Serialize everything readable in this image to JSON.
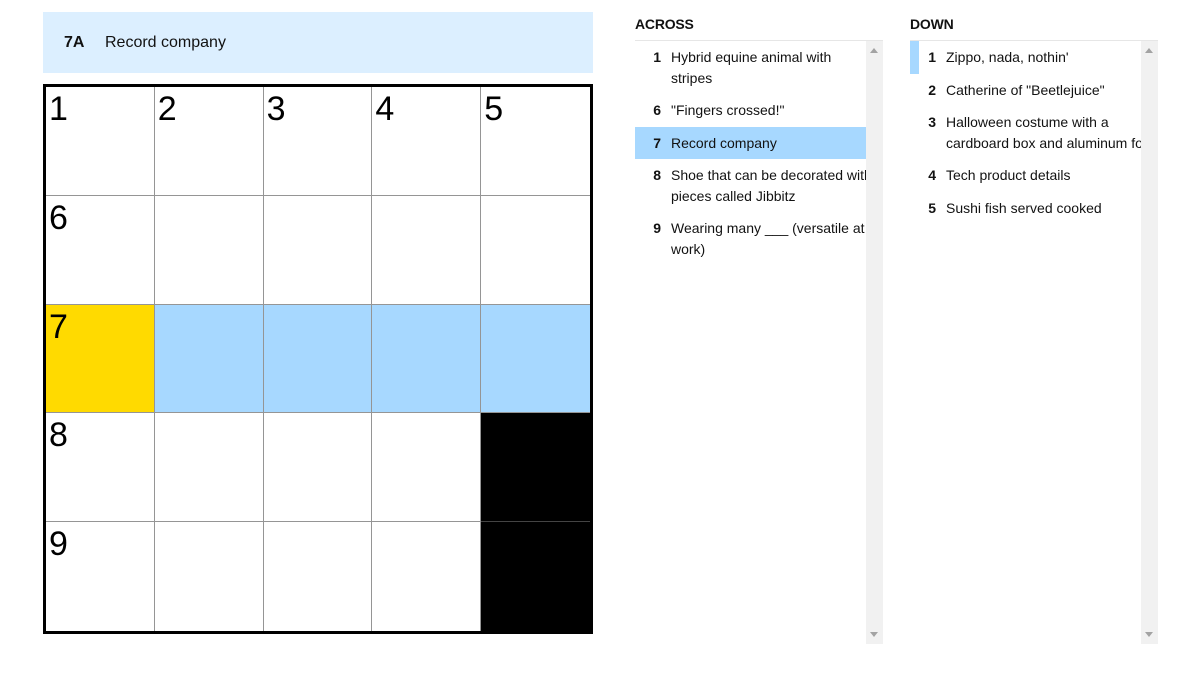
{
  "current_clue": {
    "number": "7A",
    "text": "Record company"
  },
  "grid": {
    "rows": [
      [
        {
          "num": "1",
          "type": "white"
        },
        {
          "num": "2",
          "type": "white"
        },
        {
          "num": "3",
          "type": "white"
        },
        {
          "num": "4",
          "type": "white"
        },
        {
          "num": "5",
          "type": "white"
        }
      ],
      [
        {
          "num": "6",
          "type": "white"
        },
        {
          "num": "",
          "type": "white"
        },
        {
          "num": "",
          "type": "white"
        },
        {
          "num": "",
          "type": "white"
        },
        {
          "num": "",
          "type": "white"
        }
      ],
      [
        {
          "num": "7",
          "type": "active"
        },
        {
          "num": "",
          "type": "highlight"
        },
        {
          "num": "",
          "type": "highlight"
        },
        {
          "num": "",
          "type": "highlight"
        },
        {
          "num": "",
          "type": "highlight"
        }
      ],
      [
        {
          "num": "8",
          "type": "white"
        },
        {
          "num": "",
          "type": "white"
        },
        {
          "num": "",
          "type": "white"
        },
        {
          "num": "",
          "type": "white"
        },
        {
          "num": "",
          "type": "block"
        }
      ],
      [
        {
          "num": "9",
          "type": "white"
        },
        {
          "num": "",
          "type": "white"
        },
        {
          "num": "",
          "type": "white"
        },
        {
          "num": "",
          "type": "white"
        },
        {
          "num": "",
          "type": "block"
        }
      ]
    ]
  },
  "colors": {
    "active_cell": "#ffda00",
    "highlight": "#a7d8ff",
    "clue_bar": "#dcefff"
  },
  "across": {
    "title": "ACROSS",
    "clues": [
      {
        "num": "1",
        "text": "Hybrid equine animal with stripes"
      },
      {
        "num": "6",
        "text": "\"Fingers crossed!\""
      },
      {
        "num": "7",
        "text": "Record company",
        "selected": true
      },
      {
        "num": "8",
        "text": "Shoe that can be decorated with pieces called Jibbitz"
      },
      {
        "num": "9",
        "text": "Wearing many ___ (versatile at work)"
      }
    ]
  },
  "down": {
    "title": "DOWN",
    "clues": [
      {
        "num": "1",
        "text": "Zippo, nada, nothin'",
        "crossing": true
      },
      {
        "num": "2",
        "text": "Catherine of \"Beetlejuice\""
      },
      {
        "num": "3",
        "text": "Halloween costume with a cardboard box and aluminum foil"
      },
      {
        "num": "4",
        "text": "Tech product details"
      },
      {
        "num": "5",
        "text": "Sushi fish served cooked"
      }
    ]
  }
}
